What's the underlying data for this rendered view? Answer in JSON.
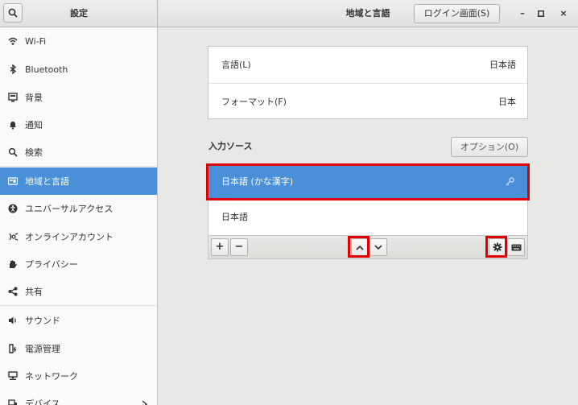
{
  "window": {
    "app_title": "設定",
    "panel_title": "地域と言語",
    "login_button": "ログイン画面(S)",
    "minimize": "–",
    "maximize": "□",
    "close": "×"
  },
  "sidebar": {
    "items": [
      {
        "label": "Wi-Fi",
        "icon": "wifi-icon"
      },
      {
        "label": "Bluetooth",
        "icon": "bluetooth-icon"
      },
      {
        "label": "背景",
        "icon": "background-icon"
      },
      {
        "label": "通知",
        "icon": "bell-icon"
      },
      {
        "label": "検索",
        "icon": "search-icon"
      },
      {
        "label": "地域と言語",
        "icon": "region-icon",
        "active": true
      },
      {
        "label": "ユニバーサルアクセス",
        "icon": "accessibility-icon"
      },
      {
        "label": "オンラインアカウント",
        "icon": "online-accounts-icon"
      },
      {
        "label": "プライバシー",
        "icon": "privacy-hand-icon"
      },
      {
        "label": "共有",
        "icon": "share-icon"
      },
      {
        "label": "サウンド",
        "icon": "speaker-icon"
      },
      {
        "label": "電源管理",
        "icon": "power-icon"
      },
      {
        "label": "ネットワーク",
        "icon": "network-icon"
      },
      {
        "label": "デバイス",
        "icon": "devices-icon"
      }
    ]
  },
  "language_section": {
    "language_label": "言語(L)",
    "language_value": "日本語",
    "format_label": "フォーマット(F)",
    "format_value": "日本"
  },
  "input_sources": {
    "title": "入力ソース",
    "options_button": "オプション(O)",
    "items": [
      {
        "label": "日本語 (かな漢字)",
        "selected": true
      },
      {
        "label": "日本語",
        "selected": false
      }
    ],
    "toolbar": {
      "add": "+",
      "remove": "−"
    }
  },
  "colors": {
    "accent": "#4a90d9",
    "highlight": "#e00000"
  }
}
